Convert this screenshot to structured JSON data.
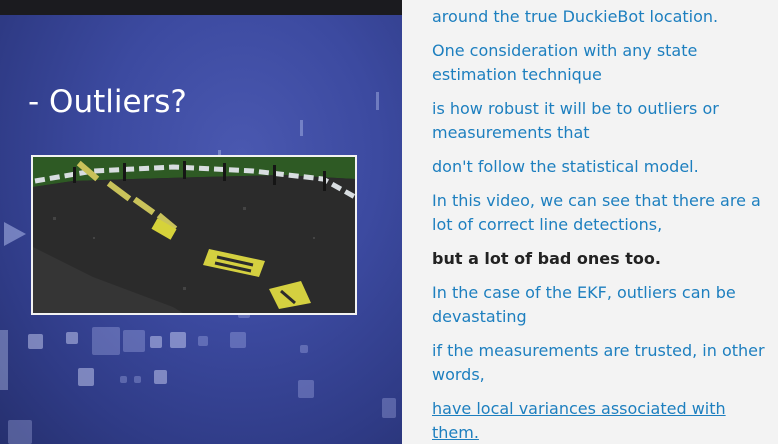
{
  "video": {
    "slide_title": "- Outliers?",
    "accent_color": "#3f4ca2",
    "title_color": "#ffffff"
  },
  "transcript": {
    "link_color": "#1d7fbf",
    "current_color": "#222222",
    "lines": [
      {
        "text": "around the true DuckieBot location.",
        "state": "normal"
      },
      {
        "text": "One consideration with any state estimation technique",
        "state": "normal"
      },
      {
        "text": "is how robust it will be to outliers or measurements that",
        "state": "normal"
      },
      {
        "text": "don't follow the statistical model.",
        "state": "normal"
      },
      {
        "text": "In this video, we can see that there are a lot of correct line detections,",
        "state": "normal"
      },
      {
        "text": "but a lot of bad ones too.",
        "state": "current"
      },
      {
        "text": "In the case of the EKF, outliers can be devastating",
        "state": "normal"
      },
      {
        "text": "if the measurements are trusted, in other words,",
        "state": "normal"
      },
      {
        "text": "have local variances associated with them.",
        "state": "underlined"
      }
    ]
  }
}
